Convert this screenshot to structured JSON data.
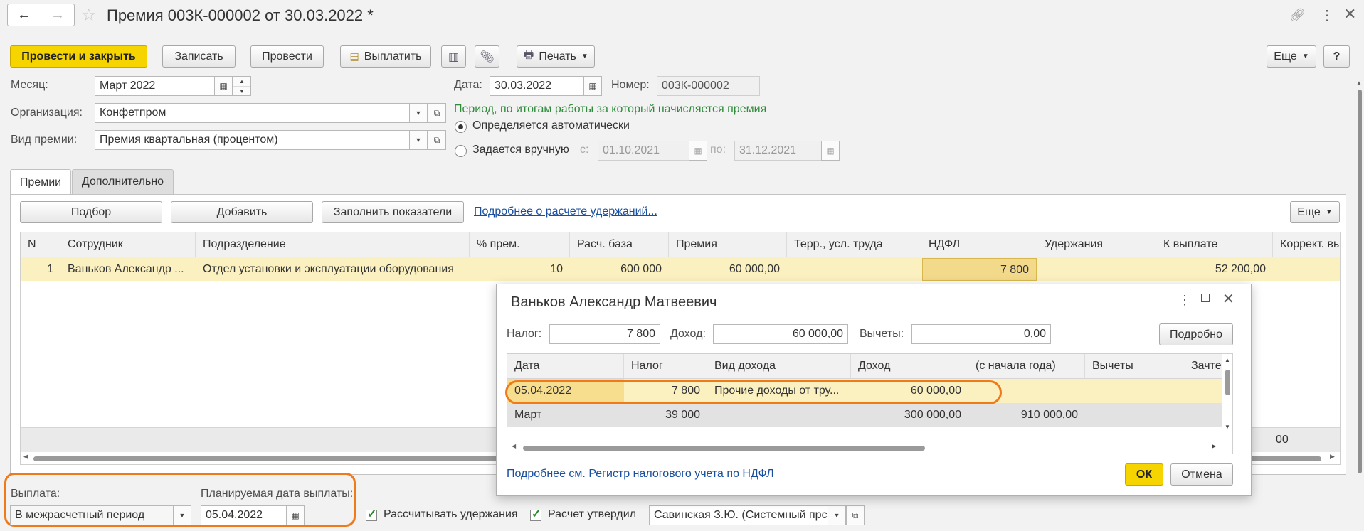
{
  "header": {
    "title": "Премия 003К-000002 от 30.03.2022 *"
  },
  "toolbar": {
    "post_close": "Провести и закрыть",
    "write": "Записать",
    "post": "Провести",
    "pay": "Выплатить",
    "print": "Печать",
    "more": "Еще",
    "help": "?"
  },
  "form": {
    "month_label": "Месяц:",
    "month_value": "Март 2022",
    "org_label": "Организация:",
    "org_value": "Конфетпром",
    "type_label": "Вид премии:",
    "type_value": "Премия квартальная (процентом)",
    "date_label": "Дата:",
    "date_value": "30.03.2022",
    "number_label": "Номер:",
    "number_value": "003К-000002",
    "period_title": "Период, по итогам работы за который начисляется премия",
    "radio_auto": "Определяется автоматически",
    "radio_manual": "Задается вручную",
    "from_label": "с:",
    "from_value": "01.10.2021",
    "to_label": "по:",
    "to_value": "31.12.2021"
  },
  "tabs": [
    "Премии",
    "Дополнительно"
  ],
  "table_toolbar": {
    "pick": "Подбор",
    "add": "Добавить",
    "fill": "Заполнить показатели",
    "link": "Подробнее о расчете удержаний...",
    "more": "Еще"
  },
  "table": {
    "columns": [
      "N",
      "Сотрудник",
      "Подразделение",
      "% прем.",
      "Расч. база",
      "Премия",
      "Терр., усл. труда",
      "НДФЛ",
      "Удержания",
      "К выплате",
      "Коррект. вы"
    ],
    "rows": [
      [
        "1",
        "Ваньков Александр ...",
        "Отдел установки и эксплуатации оборудования",
        "10",
        "600 000",
        "60 000,00",
        "",
        "7 800",
        "",
        "52 200,00",
        ""
      ]
    ],
    "footer_partial": "00"
  },
  "bottom": {
    "payment_label": "Выплата:",
    "payment_value": "В межрасчетный период",
    "planned_label": "Планируемая дата выплаты:",
    "planned_value": "05.04.2022",
    "calc_deductions": "Рассчитывать удержания",
    "calc_approved": "Расчет утвердил",
    "approver": "Савинская З.Ю. (Системный прс"
  },
  "popup": {
    "title": "Ваньков Александр Матвеевич",
    "tax_label": "Налог:",
    "tax_value": "7 800",
    "income_label": "Доход:",
    "income_value": "60 000,00",
    "deductions_label": "Вычеты:",
    "deductions_value": "0,00",
    "details_btn": "Подробно",
    "columns": [
      "Дата",
      "Налог",
      "Вид дохода",
      "Доход",
      "(с начала года)",
      "Вычеты",
      "Зачте"
    ],
    "rows": [
      [
        "05.04.2022",
        "7 800",
        "Прочие доходы от тру...",
        "60 000,00",
        "",
        "",
        ""
      ]
    ],
    "total": [
      "Март",
      "39 000",
      "",
      "300 000,00",
      "910 000,00",
      "",
      ""
    ],
    "register_link": "Подробнее см. Регистр налогового учета по НДФЛ",
    "ok": "ОК",
    "cancel": "Отмена"
  },
  "colors": {
    "accent_yellow": "#f5d400",
    "highlight_orange": "#f07a1a",
    "selected_row": "#faf0c0",
    "link_blue": "#1a4fa0",
    "period_green": "#2e8b3a"
  }
}
